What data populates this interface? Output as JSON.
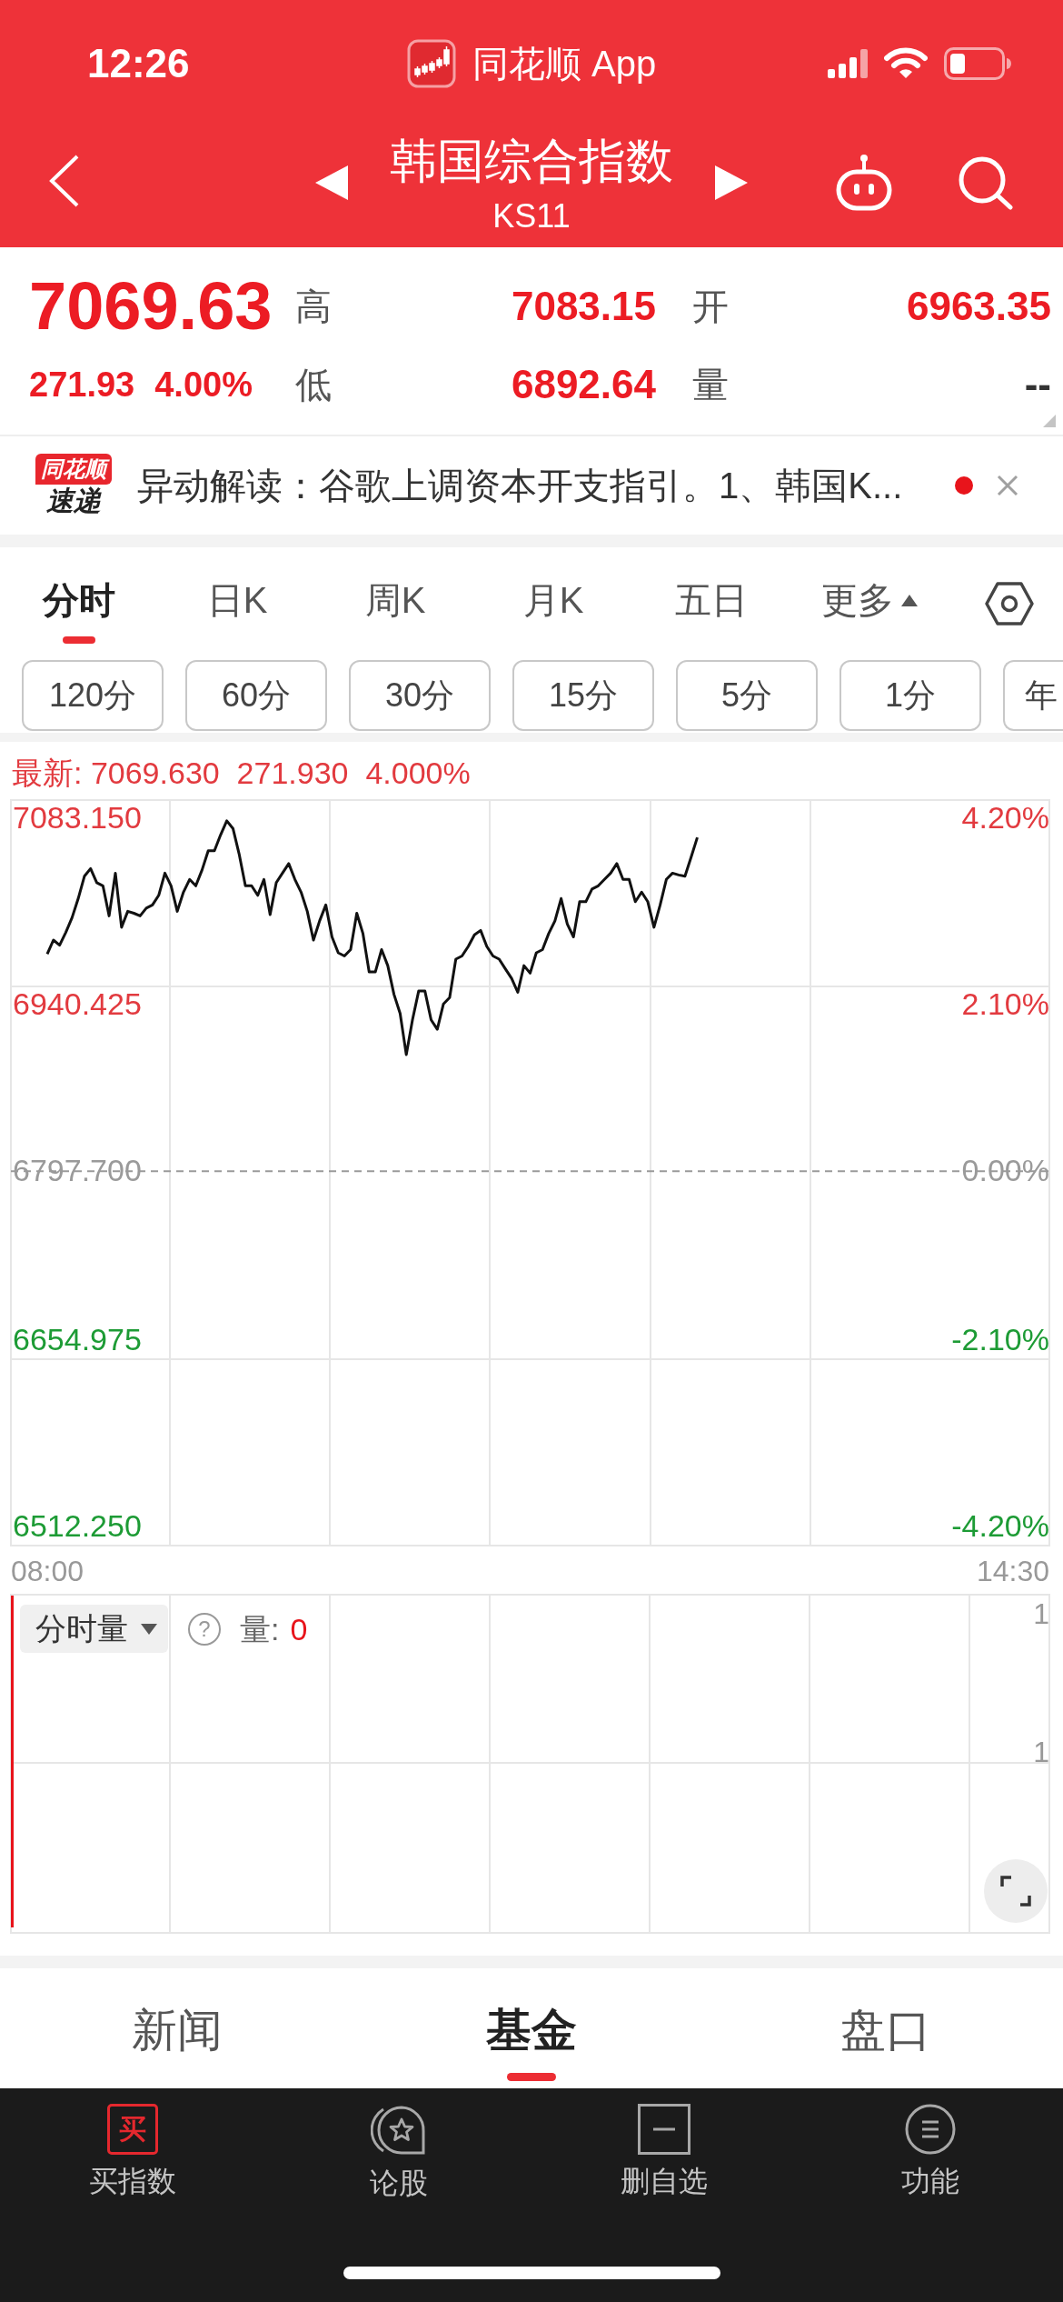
{
  "status_bar": {
    "time": "12:26",
    "app_name": "同花顺 App"
  },
  "header": {
    "title": "韩国综合指数",
    "code": "KS11"
  },
  "quote": {
    "price": "7069.63",
    "change": "271.93",
    "percent": "4.00%",
    "color": "#ec1c24",
    "stats": [
      {
        "label": "高",
        "value": "7083.15",
        "color": "#ec1c24"
      },
      {
        "label": "开",
        "value": "6963.35",
        "color": "#ec1c24"
      },
      {
        "label": "低",
        "value": "6892.64",
        "color": "#ec1c24"
      },
      {
        "label": "量",
        "value": "--",
        "color": "#333333"
      }
    ]
  },
  "news": {
    "badge_top": "同花顺",
    "badge_bottom": "速递",
    "text": "异动解读：谷歌上调资本开支指引。1、韩国K...",
    "unread": true
  },
  "chart_tabs": [
    {
      "label": "分时",
      "selected": true,
      "kind": "tab"
    },
    {
      "label": "日K",
      "selected": false,
      "kind": "tab"
    },
    {
      "label": "周K",
      "selected": false,
      "kind": "tab"
    },
    {
      "label": "月K",
      "selected": false,
      "kind": "tab"
    },
    {
      "label": "五日",
      "selected": false,
      "kind": "tab"
    },
    {
      "label": "更多",
      "selected": false,
      "kind": "menu"
    }
  ],
  "periods": [
    {
      "label": "120分",
      "selected": false
    },
    {
      "label": "60分",
      "selected": false
    },
    {
      "label": "30分",
      "selected": false
    },
    {
      "label": "15分",
      "selected": false
    },
    {
      "label": "5分",
      "selected": false
    },
    {
      "label": "1分",
      "selected": false
    },
    {
      "label": "年",
      "selected": false
    }
  ],
  "price_chart": {
    "latest": {
      "label": "最新:",
      "price": "7069.630",
      "change": "271.930",
      "percent": "4.000%"
    },
    "right_axis_labels": [
      {
        "text": "4.20%",
        "color": "#e23a3f"
      },
      {
        "text": "2.10%",
        "color": "#e23a3f"
      },
      {
        "text": "0.00%",
        "color": "#9a9a9a"
      },
      {
        "text": "-2.10%",
        "color": "#1d9b35"
      },
      {
        "text": "-4.20%",
        "color": "#1d9b35"
      }
    ],
    "chart_data": {
      "type": "line",
      "categories": [
        "08:00",
        null,
        null,
        null,
        null,
        null,
        null,
        null,
        null,
        null,
        null,
        null,
        null,
        null,
        null,
        null,
        null,
        null,
        null,
        null,
        null,
        null,
        null,
        null,
        null,
        null,
        null,
        null,
        null,
        null,
        null,
        null,
        null,
        null,
        null,
        null,
        null,
        null,
        null,
        null,
        null,
        null,
        null,
        null,
        null,
        null,
        null,
        null,
        null,
        null,
        null,
        null,
        null,
        null,
        null,
        null,
        null,
        null,
        null,
        null,
        null,
        null,
        null,
        null,
        null,
        null,
        null,
        null,
        null,
        null,
        null,
        null,
        null,
        null,
        null,
        null,
        null,
        null,
        null,
        null,
        null,
        null,
        null,
        null,
        null,
        null,
        null,
        null,
        null,
        null,
        null,
        null,
        null,
        null,
        null,
        null,
        null,
        null,
        null,
        null,
        null,
        null,
        null,
        null,
        null,
        null,
        null,
        null,
        null,
        null,
        null,
        null,
        null,
        null,
        null,
        null,
        null,
        null,
        null,
        null,
        null,
        null,
        null,
        null,
        null,
        null,
        null,
        null,
        null,
        null,
        null,
        null,
        null,
        null,
        null,
        null,
        null,
        null,
        null,
        null,
        null,
        null,
        null,
        null,
        null,
        null,
        null,
        null,
        null,
        null,
        null,
        null,
        null,
        null,
        null,
        null,
        "14:30"
      ],
      "values": [
        6974.6,
        6986.0,
        6981.8,
        6992.2,
        7004.2,
        7019.8,
        7038.0,
        7044.2,
        7032.8,
        7030.2,
        7005.7,
        7040.5,
        6996.4,
        7009.4,
        7007.8,
        7005.7,
        7012.0,
        7014.6,
        7022.4,
        7040.5,
        7030.2,
        7009.4,
        7025.0,
        7035.4,
        7030.2,
        7043.1,
        7058.7,
        7058.7,
        7071.7,
        7083.1,
        7076.9,
        7056.1,
        7030.2,
        7030.2,
        7022.4,
        7035.4,
        7006.8,
        7032.8,
        7040.5,
        7048.3,
        7035.4,
        7025.0,
        7009.4,
        6986.0,
        7001.6,
        7014.6,
        6988.6,
        6975.6,
        6973.0,
        6978.2,
        7007.8,
        6991.2,
        6960.0,
        6960.0,
        6978.2,
        6965.2,
        6941.8,
        6926.2,
        6892.6,
        6921.0,
        6944.4,
        6944.4,
        6921.0,
        6913.3,
        6934.0,
        6939.2,
        6970.4,
        6973.0,
        6980.8,
        6990.2,
        6993.8,
        6980.8,
        6973.0,
        6970.4,
        6962.6,
        6954.8,
        6943.4,
        6965.2,
        6959.0,
        6975.6,
        6978.2,
        6991.2,
        7001.6,
        7019.8,
        6999.0,
        6988.6,
        7017.2,
        7017.2,
        7027.6,
        7030.2,
        7035.4,
        7040.5,
        7048.3,
        7035.4,
        7035.4,
        7017.2,
        7025.0,
        7017.2,
        6996.4,
        7014.6,
        7035.4,
        7040.5,
        7039.0,
        7038.0,
        7053.5,
        7069.6,
        null,
        null,
        null,
        null,
        null,
        null,
        null,
        null,
        null,
        null,
        null,
        null,
        null,
        null,
        null,
        null,
        null,
        null,
        null,
        null,
        null,
        null,
        null,
        null,
        null,
        null,
        null,
        null,
        null,
        null,
        null,
        null,
        null,
        null,
        null,
        null,
        null,
        null,
        null,
        null,
        null,
        null,
        null,
        null,
        null,
        null,
        null,
        null,
        null,
        null,
        null
      ],
      "ylim": [
        6512.25,
        7083.15
      ],
      "yticks": [
        {
          "value": 7083.15,
          "label": "7083.150"
        },
        {
          "value": 6940.425,
          "label": "6940.425"
        },
        {
          "value": 6797.7,
          "label": "6797.700"
        },
        {
          "value": 6654.975,
          "label": "6654.975"
        },
        {
          "value": 6512.25,
          "label": "6512.250"
        }
      ],
      "ref_lines": [
        {
          "axis": "y",
          "value": 6797.7
        }
      ]
    }
  },
  "volume_panel": {
    "indicator": "分时量",
    "help_glyph": "?",
    "label": "量:",
    "value": "0",
    "axis_labels": [
      "1",
      "1"
    ]
  },
  "bottom_tabs": [
    {
      "label": "新闻",
      "selected": false
    },
    {
      "label": "基金",
      "selected": true
    },
    {
      "label": "盘口",
      "selected": false
    }
  ],
  "toolbar": [
    {
      "label": "买指数",
      "kind": "buy",
      "icon_text": "买"
    },
    {
      "label": "论股",
      "kind": "discuss"
    },
    {
      "label": "删自选",
      "kind": "remove"
    },
    {
      "label": "功能",
      "kind": "menu"
    }
  ]
}
